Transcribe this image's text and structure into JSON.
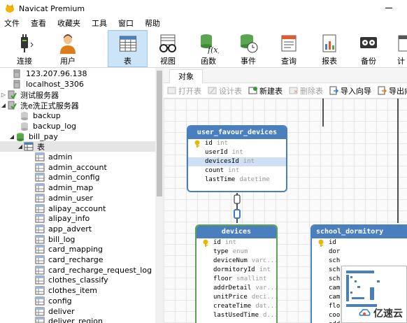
{
  "window": {
    "title": "Navicat Premium"
  },
  "menu": [
    "文件",
    "查看",
    "收藏夹",
    "工具",
    "窗口",
    "帮助"
  ],
  "toolbar": [
    {
      "label": "连接",
      "icon": "plug-icon"
    },
    {
      "label": "用户",
      "icon": "user-icon"
    },
    {
      "label": "表",
      "icon": "table-icon",
      "active": true
    },
    {
      "label": "视图",
      "icon": "glasses-icon"
    },
    {
      "label": "函数",
      "icon": "function-icon"
    },
    {
      "label": "事件",
      "icon": "event-clock-icon"
    },
    {
      "label": "查询",
      "icon": "query-icon"
    },
    {
      "label": "报表",
      "icon": "report-icon"
    },
    {
      "label": "备份",
      "icon": "backup-icon"
    },
    {
      "label": "计",
      "icon": "schedule-icon"
    }
  ],
  "sidebar": {
    "items": [
      {
        "label": "123.207.96.138",
        "type": "server"
      },
      {
        "label": "localhost_3306",
        "type": "server"
      },
      {
        "label": "测试服务器",
        "type": "server-connected"
      },
      {
        "label": "洗e洗正式服务器",
        "type": "server-connected"
      },
      {
        "label": "backup",
        "type": "database"
      },
      {
        "label": "backup_log",
        "type": "database"
      },
      {
        "label": "bill_pay",
        "type": "database-open"
      },
      {
        "label": "表",
        "type": "tables-folder"
      },
      {
        "label": "admin",
        "type": "table"
      },
      {
        "label": "admin_account",
        "type": "table"
      },
      {
        "label": "admin_config",
        "type": "table"
      },
      {
        "label": "admin_map",
        "type": "table"
      },
      {
        "label": "admin_user",
        "type": "table"
      },
      {
        "label": "alipay_account",
        "type": "table"
      },
      {
        "label": "alipay_info",
        "type": "table"
      },
      {
        "label": "app_advert",
        "type": "table"
      },
      {
        "label": "bill_log",
        "type": "table"
      },
      {
        "label": "card_mapping",
        "type": "table"
      },
      {
        "label": "card_recharge",
        "type": "table"
      },
      {
        "label": "card_recharge_request_log",
        "type": "table"
      },
      {
        "label": "clothes_classify",
        "type": "table"
      },
      {
        "label": "clothes_item",
        "type": "table"
      },
      {
        "label": "config",
        "type": "table"
      },
      {
        "label": "deliver",
        "type": "table"
      },
      {
        "label": "deliver_region",
        "type": "table"
      }
    ]
  },
  "tabs": {
    "objects": "对象"
  },
  "object_toolbar": [
    {
      "label": "打开表",
      "enabled": false,
      "icon": "open-table-icon"
    },
    {
      "label": "设计表",
      "enabled": false,
      "icon": "design-table-icon"
    },
    {
      "label": "新建表",
      "enabled": true,
      "icon": "new-table-icon"
    },
    {
      "label": "删除表",
      "enabled": false,
      "icon": "delete-table-icon"
    },
    {
      "label": "导入向导",
      "enabled": true,
      "icon": "import-wizard-icon"
    },
    {
      "label": "导出向导",
      "enabled": true,
      "icon": "export-wizard-icon"
    }
  ],
  "entities": {
    "user_favour_devices": {
      "title": "user_favour_devices",
      "fields": [
        {
          "name": "id",
          "type": "int",
          "key": true
        },
        {
          "name": "userId",
          "type": "int"
        },
        {
          "name": "devicesId",
          "type": "int",
          "highlight": true
        },
        {
          "name": "count",
          "type": "int"
        },
        {
          "name": "lastTime",
          "type": "datetime"
        }
      ]
    },
    "devices": {
      "title": "devices",
      "fields": [
        {
          "name": "id",
          "type": "int",
          "key": true
        },
        {
          "name": "type",
          "type": "enum"
        },
        {
          "name": "deviceNum",
          "type": "varc..."
        },
        {
          "name": "dormitoryId",
          "type": "int"
        },
        {
          "name": "floor",
          "type": "smallint"
        },
        {
          "name": "addrDetail",
          "type": "var..."
        },
        {
          "name": "unitPrice",
          "type": "deci..."
        },
        {
          "name": "createTime",
          "type": "dat..."
        },
        {
          "name": "lastUsedTime",
          "type": "d..."
        }
      ]
    },
    "school_dormitory": {
      "title": "school_dormitory",
      "fields": [
        {
          "name": "id",
          "type": "",
          "key": true
        },
        {
          "name": "dor",
          "type": ""
        },
        {
          "name": "sch",
          "type": ""
        },
        {
          "name": "sch",
          "type": ""
        },
        {
          "name": "sch",
          "type": ""
        },
        {
          "name": "cam",
          "type": ""
        },
        {
          "name": "cam",
          "type": ""
        },
        {
          "name": "flo",
          "type": ""
        },
        {
          "name": "coo",
          "type": ""
        },
        {
          "name": "add",
          "type": ""
        }
      ]
    }
  },
  "watermark": {
    "text": "亿速云"
  },
  "colors": {
    "entity_header_blue": "#4a7fbf",
    "entity_header_green": "#5aa64f",
    "selected_toolbar": "#cce4f7"
  }
}
